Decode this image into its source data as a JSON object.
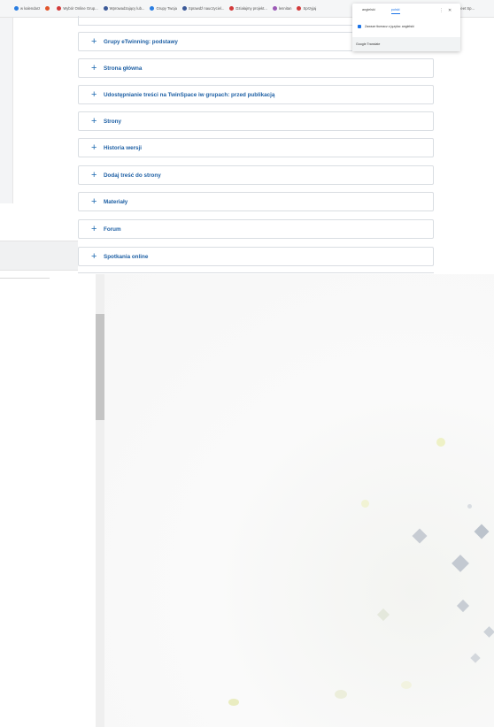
{
  "bookmarks": [
    {
      "label": "w kalendarz",
      "color": "#2a7de1"
    },
    {
      "label": "",
      "color": "#e1542a"
    },
    {
      "label": "Wybór Online Grup...",
      "color": "#d23a3a"
    },
    {
      "label": "Wprowadzający lub...",
      "color": "#3b5998"
    },
    {
      "label": "Grupy Twoja",
      "color": "#2a7de1"
    },
    {
      "label": "Sprawdź nauczyciel...",
      "color": "#3b5998"
    },
    {
      "label": "Działajmy projekt...",
      "color": "#d23a3a"
    },
    {
      "label": "lennitan",
      "color": "#9b59b6"
    },
    {
      "label": "Sprzyjaj",
      "color": "#d23a3a"
    }
  ],
  "bookmarks_trailing": "Meet Sp...",
  "translate_popup": {
    "tab_source": "angielski",
    "tab_target": "polski",
    "always_translate_label": "Zawsze tłumacz z języka: angielski",
    "footer": "Google Translate",
    "menu_icon": "⋮",
    "close_icon": "✕"
  },
  "accordion": [
    {
      "label": "Grupy eTwinning: podstawy"
    },
    {
      "label": "Strona główna"
    },
    {
      "label": "Udostępnianie treści na TwinSpace iw grupach: przed publikacją"
    },
    {
      "label": "Strony"
    },
    {
      "label": "Historia wersji"
    },
    {
      "label": "Dodaj treść do strony"
    },
    {
      "label": "Materiały"
    },
    {
      "label": "Forum"
    },
    {
      "label": "Spotkania online"
    }
  ],
  "plus_icon": "+"
}
